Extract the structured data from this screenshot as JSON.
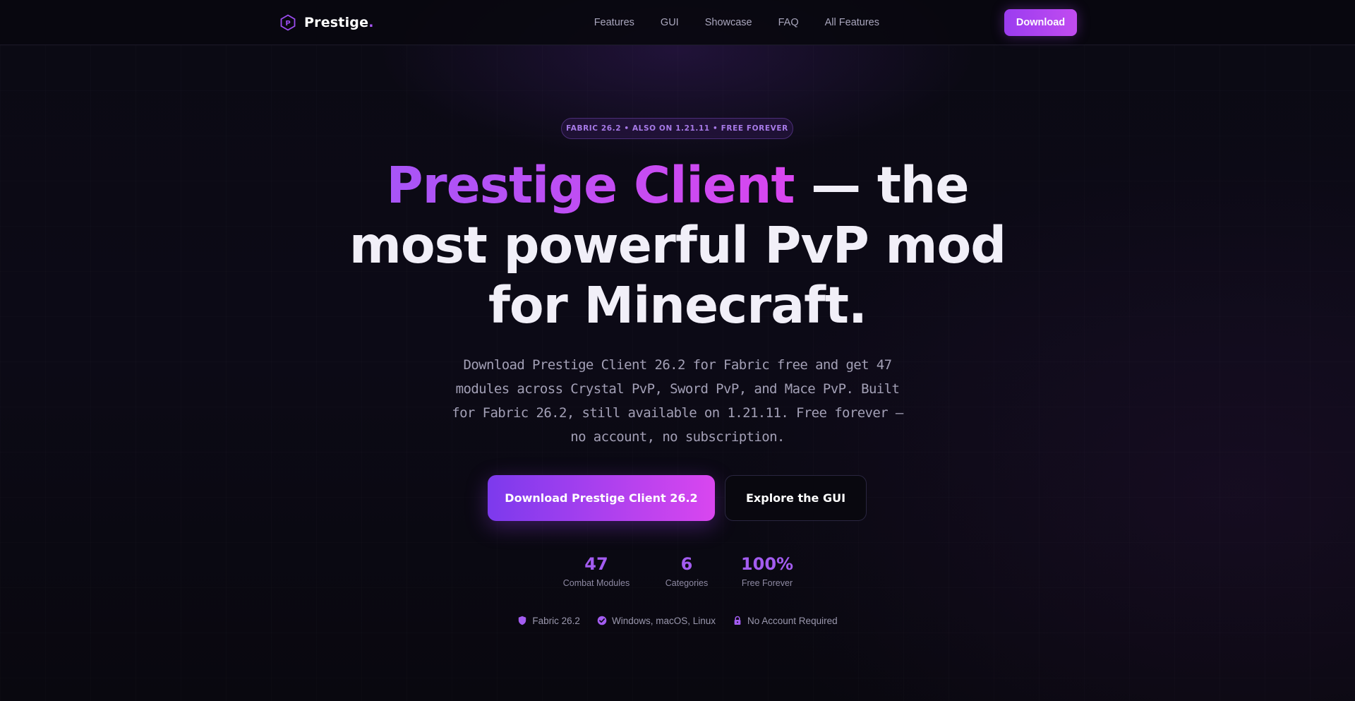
{
  "brand": {
    "name": "Prestige",
    "dot": ".",
    "icon": "hexagon-p-logo-icon",
    "accent_color": "#a855f7"
  },
  "nav": {
    "links": [
      "Features",
      "GUI",
      "Showcase",
      "FAQ",
      "All Features"
    ],
    "download_label": "Download"
  },
  "hero": {
    "badge": "FABRIC 26.2 • ALSO ON 1.21.11 • FREE FOREVER",
    "headline_accent": "Prestige Client",
    "headline_rest_1": " — the",
    "headline_line_2": "most powerful PvP mod",
    "headline_line_3": "for Minecraft.",
    "subtitle": "Download Prestige Client 26.2 for Fabric free and get 47 modules across Crystal PvP, Sword PvP, and Mace PvP. Built for Fabric 26.2, still available on 1.21.11. Free forever — no account, no subscription.",
    "primary_cta": "Download Prestige Client 26.2",
    "secondary_cta": "Explore the GUI"
  },
  "stats": [
    {
      "value": "47",
      "label": "Combat Modules"
    },
    {
      "value": "6",
      "label": "Categories"
    },
    {
      "value": "100%",
      "label": "Free Forever"
    }
  ],
  "features": [
    {
      "icon": "shield-icon",
      "text": "Fabric 26.2"
    },
    {
      "icon": "check-circle-icon",
      "text": "Windows, macOS, Linux"
    },
    {
      "icon": "lock-icon",
      "text": "No Account Required"
    }
  ],
  "gradient_colors": {
    "start": "#7c3aed",
    "end": "#d946ef"
  }
}
